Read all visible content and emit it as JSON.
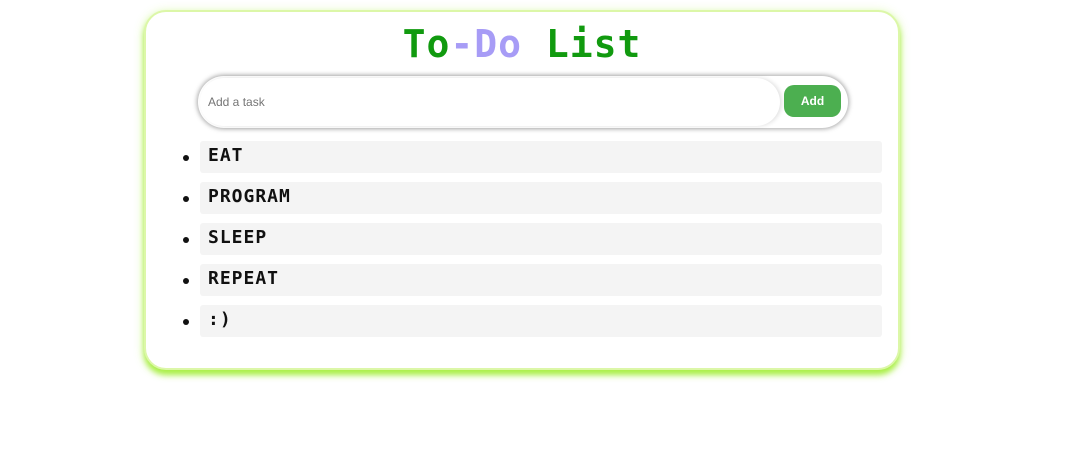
{
  "title": {
    "part1": "To",
    "part2": "-Do",
    "part3": " List",
    "colors": {
      "green": "#119a0f",
      "purple": "#a79cf6"
    }
  },
  "input": {
    "placeholder": "Add a task",
    "value": ""
  },
  "add_button": {
    "label": "Add",
    "color": "#4caf50"
  },
  "tasks": [
    {
      "text": "EAT"
    },
    {
      "text": "PROGRAM"
    },
    {
      "text": "SLEEP"
    },
    {
      "text": "REPEAT"
    },
    {
      "text": ":)"
    }
  ],
  "card": {
    "glow_color": "#b6f04a"
  }
}
